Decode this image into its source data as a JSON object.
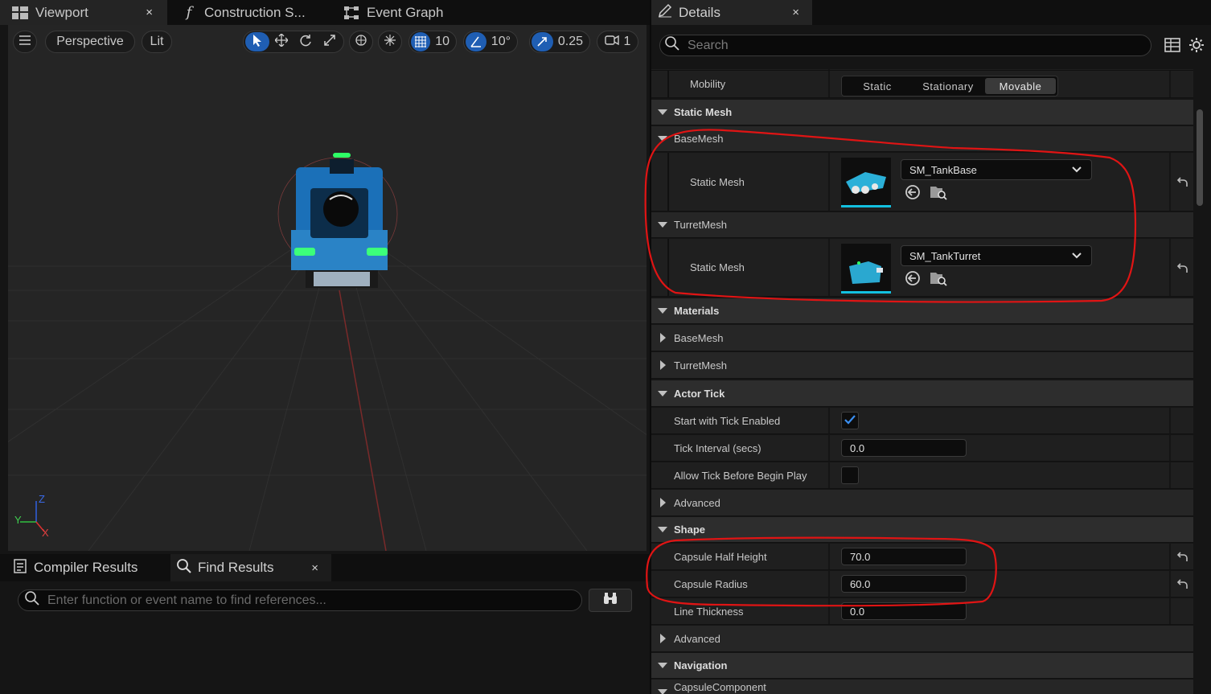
{
  "left_tabs": [
    {
      "label": "Viewport",
      "close": "×"
    },
    {
      "label": "Construction S..."
    },
    {
      "label": "Event Graph"
    }
  ],
  "viewport": {
    "perspective": "Perspective",
    "lit": "Lit",
    "grid_snap": "10",
    "rot_snap": "10°",
    "scale_snap": "0.25",
    "cam_speed": "1",
    "axis_x": "X",
    "axis_y": "Y",
    "axis_z": "Z"
  },
  "bottom_tabs": {
    "compiler": "Compiler Results",
    "find": "Find Results",
    "close": "×",
    "search_placeholder": "Enter function or event name to find references..."
  },
  "details": {
    "tab": "Details",
    "close": "×",
    "search_placeholder": "Search",
    "mobility": {
      "label": "Mobility",
      "options": [
        "Static",
        "Stationary",
        "Movable"
      ],
      "selected": "Movable"
    },
    "static_mesh_cat": "Static Mesh",
    "basemesh": {
      "label": "BaseMesh",
      "prop": "Static Mesh",
      "value": "SM_TankBase"
    },
    "turretmesh": {
      "label": "TurretMesh",
      "prop": "Static Mesh",
      "value": "SM_TankTurret"
    },
    "materials_cat": "Materials",
    "materials_base": "BaseMesh",
    "materials_turret": "TurretMesh",
    "actor_tick_cat": "Actor Tick",
    "start_tick": "Start with Tick Enabled",
    "tick_interval": {
      "label": "Tick Interval (secs)",
      "value": "0.0"
    },
    "allow_tick": "Allow Tick Before Begin Play",
    "advanced": "Advanced",
    "shape_cat": "Shape",
    "half_height": {
      "label": "Capsule Half Height",
      "value": "70.0"
    },
    "radius": {
      "label": "Capsule Radius",
      "value": "60.0"
    },
    "line_thickness": {
      "label": "Line Thickness",
      "value": "0.0"
    },
    "advanced2": "Advanced",
    "navigation_cat": "Navigation",
    "capsule_component": "CapsuleComponent"
  }
}
